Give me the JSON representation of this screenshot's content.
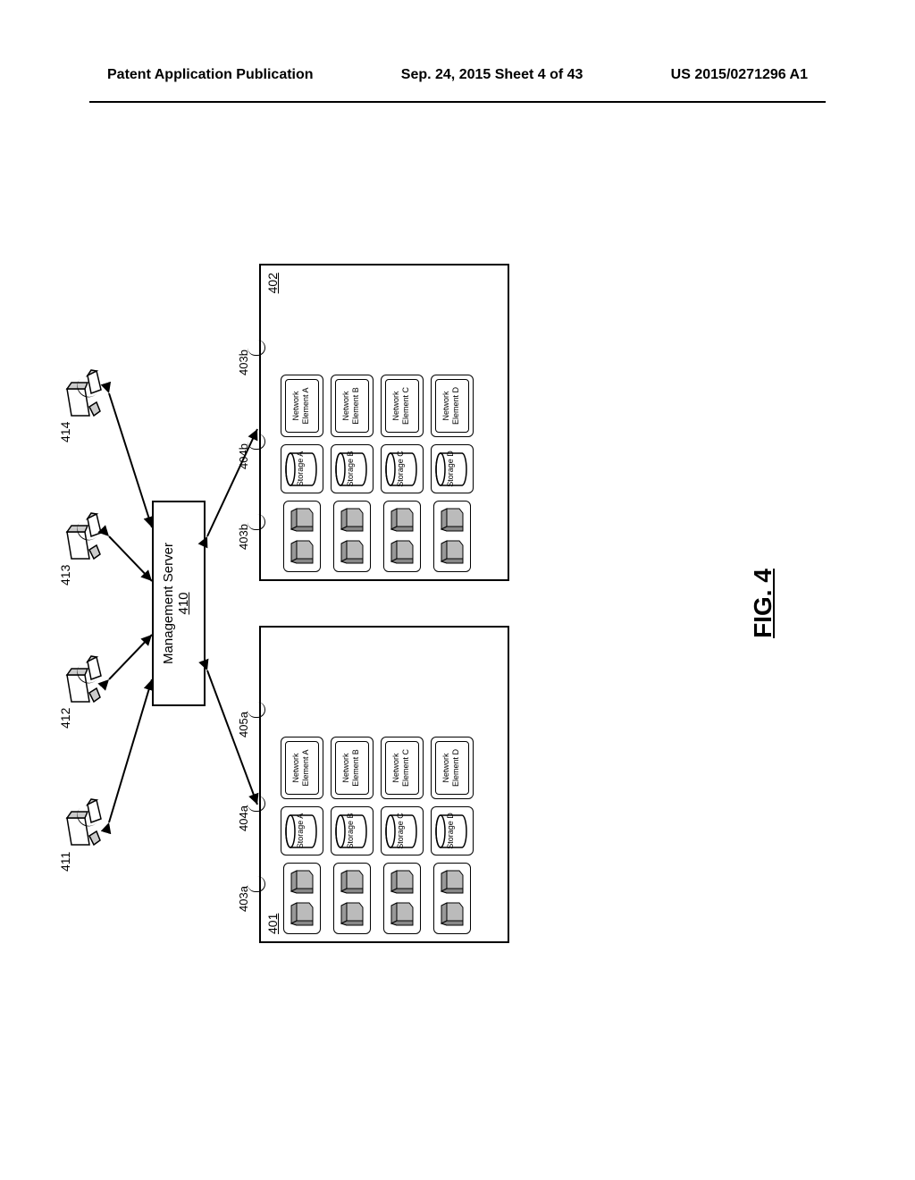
{
  "header": {
    "left": "Patent Application Publication",
    "center": "Sep. 24, 2015  Sheet 4 of 43",
    "right": "US 2015/0271296 A1"
  },
  "figure_label": "FIG. 4",
  "management_server": {
    "title": "Management Server",
    "ref": "410"
  },
  "workstations": {
    "ws1": "411",
    "ws2": "412",
    "ws3": "413",
    "ws4": "414"
  },
  "zone_a": {
    "ref": "401",
    "compute_label": "403a",
    "storage_label": "404a",
    "netelem_label": "405a",
    "storage": [
      "Storage A",
      "Storage B",
      "Storage C",
      "Storage D"
    ],
    "netelem": [
      "Network Element A",
      "Network Element B",
      "Network Element C",
      "Network Element D"
    ]
  },
  "zone_b": {
    "ref": "402",
    "compute_label": "403b",
    "storage_label": "404b",
    "netelem_label": "403b",
    "storage": [
      "Storage A",
      "Storage B",
      "Storage C",
      "Storage D"
    ],
    "netelem": [
      "Network Element A",
      "Network Element B",
      "Network Element C",
      "Network Element D"
    ]
  }
}
